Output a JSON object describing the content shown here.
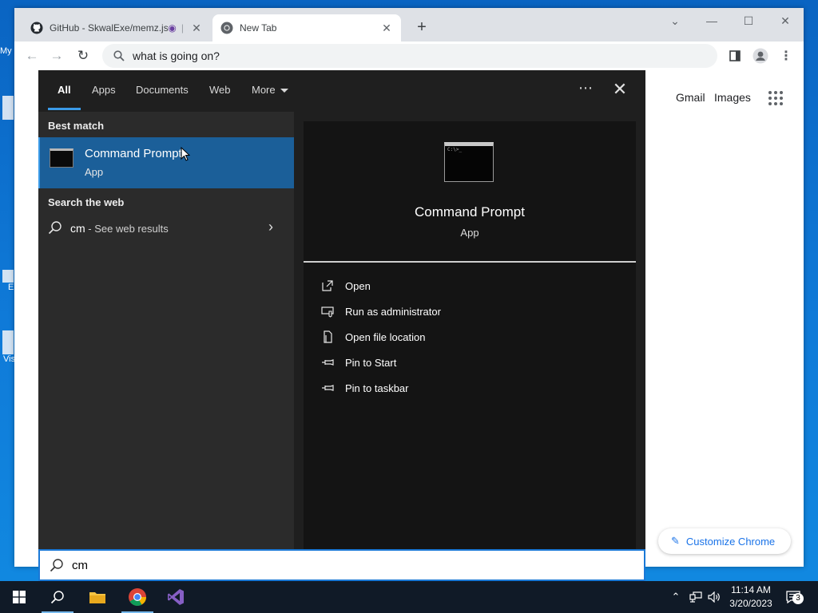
{
  "desktop": {
    "icons": [
      {
        "label": "My"
      },
      {
        "label": "E"
      },
      {
        "label": "Vis"
      }
    ]
  },
  "browser": {
    "tabs": [
      {
        "title": "GitHub - SkwalExe/memz.js:",
        "icon": "github-icon",
        "active": false
      },
      {
        "title": "New Tab",
        "icon": "chrome-icon",
        "active": true
      }
    ],
    "omnibox_value": "what is going on?",
    "links": {
      "gmail": "Gmail",
      "images": "Images"
    },
    "customize_label": "Customize Chrome"
  },
  "search": {
    "tabs": [
      "All",
      "Apps",
      "Documents",
      "Web",
      "More"
    ],
    "active_tab": "All",
    "best_match_heading": "Best match",
    "best_match": {
      "title": "Command Prompt",
      "subtitle": "App"
    },
    "web_heading": "Search the web",
    "web_result": {
      "query": "cm",
      "suffix": " - See web results"
    },
    "detail": {
      "title": "Command Prompt",
      "subtitle": "App"
    },
    "actions": [
      {
        "label": "Open",
        "icon": "open-icon"
      },
      {
        "label": "Run as administrator",
        "icon": "shield-icon"
      },
      {
        "label": "Open file location",
        "icon": "file-location-icon"
      },
      {
        "label": "Pin to Start",
        "icon": "pin-icon"
      },
      {
        "label": "Pin to taskbar",
        "icon": "pin-icon"
      }
    ],
    "input_value": "cm"
  },
  "taskbar": {
    "time": "11:14 AM",
    "date": "3/20/2023",
    "notifications": "3"
  },
  "colors": {
    "accent": "#3b9be8",
    "selection": "#1b5f99",
    "panel": "#1f1f1f",
    "taskbar": "#101a27"
  }
}
